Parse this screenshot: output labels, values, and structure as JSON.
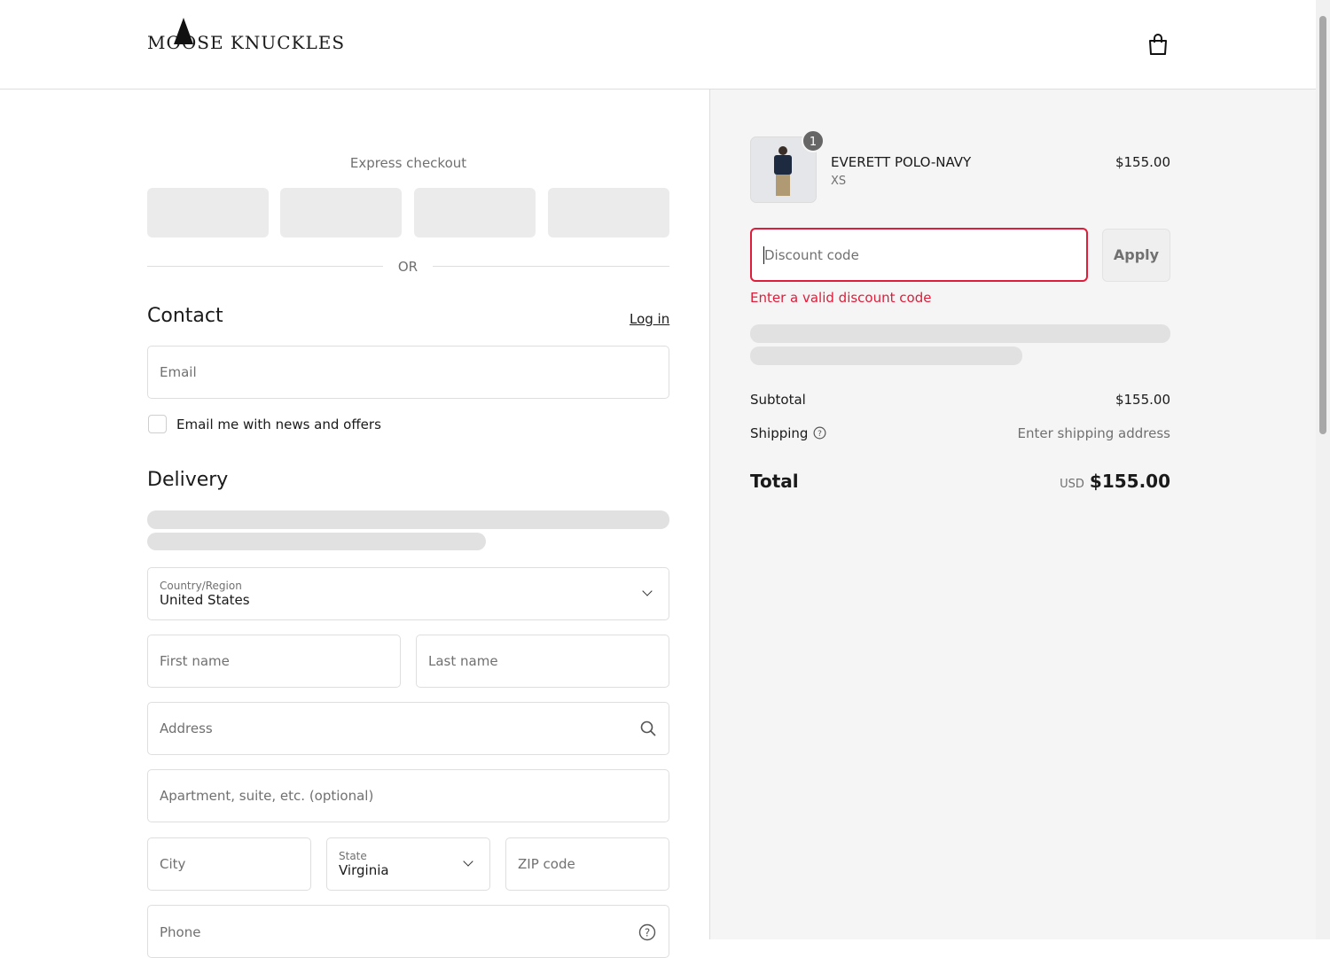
{
  "brand": {
    "name": "MOOSE KNUCKLES"
  },
  "express": {
    "title": "Express checkout",
    "or": "OR"
  },
  "contact": {
    "title": "Contact",
    "login": "Log in",
    "email_placeholder": "Email",
    "news_checkbox": "Email me with news and offers"
  },
  "delivery": {
    "title": "Delivery",
    "country_label": "Country/Region",
    "country_value": "United States",
    "first_name": "First name",
    "last_name": "Last name",
    "address": "Address",
    "apartment": "Apartment, suite, etc. (optional)",
    "city": "City",
    "state_label": "State",
    "state_value": "Virginia",
    "zip": "ZIP code",
    "phone": "Phone"
  },
  "cart": {
    "item_name": "EVERETT POLO-NAVY",
    "item_variant": "XS",
    "item_price": "$155.00",
    "quantity": "1"
  },
  "discount": {
    "placeholder": "Discount code",
    "apply": "Apply",
    "error": "Enter a valid discount code"
  },
  "summary": {
    "subtotal_label": "Subtotal",
    "subtotal_value": "$155.00",
    "shipping_label": "Shipping",
    "shipping_value": "Enter shipping address",
    "total_label": "Total",
    "currency": "USD",
    "total_value": "$155.00"
  },
  "colors": {
    "error": "#dd1d3a",
    "panel": "#f5f5f5"
  }
}
